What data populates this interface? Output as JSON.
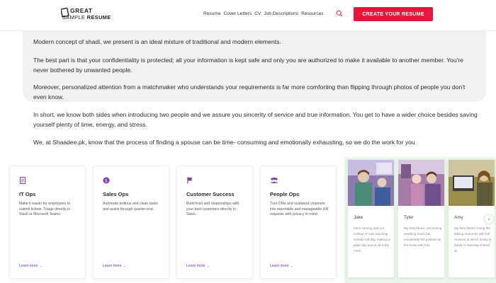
{
  "header": {
    "logo_line1": "GREAT",
    "logo_line2_a": "SAMPLE",
    "logo_line2_b": "RESUME",
    "nav": [
      "Resume",
      "Cover Letters",
      "CV",
      "Job Descriptions",
      "Resources"
    ],
    "cta_label": "CREATE YOUR RESUME",
    "accent": "#e8163c"
  },
  "article": {
    "paragraphs": [
      "Modern concept of shadi, we present is an ideal mixture of traditional and modern elements.",
      "The best part is that your confidentiality is protected; all your information is kept safe and only you are authorized to make it available to another member. You're never bothered by unwanted people.",
      "Moreover, personalized attention from a matchmaker who understands your requirements is far more comforting than flipping through photos of people you don't even know.",
      "In short, we know both sides when introducing two people and we assure you sincerity of service and true information. You get to have a wider choice besides saving yourself plenty of time, energy, and stress.",
      "We, at Shaadee.pk, know that the process of finding a spouse can be time- consuming and emotionally exhausting, so we do the work for you."
    ]
  },
  "cards": [
    {
      "icon": "document-icon",
      "title": "IT Ops",
      "text": "Make it easier for employees to submit tickets. Triage directly in Slack or Microsoft Teams.",
      "link": "Learn more →"
    },
    {
      "icon": "dollar-icon",
      "title": "Sales Ops",
      "text": "Automate tedious and clean tasks and assist through quarter-end.",
      "link": "Learn more →"
    },
    {
      "icon": "flag-icon",
      "title": "Customer Success",
      "text": "Build trust and relationships with your best customers directly in Slack.",
      "link": "Learn more →"
    },
    {
      "icon": "people-icon",
      "title": "People Ops",
      "text": "Turn DMs and scattered channels into reportable and manageable HR requests with privacy in mind.",
      "link": "Learn more →"
    }
  ],
  "profiles": [
    {
      "name": "Jake",
      "bio": "Mom coming and not coding. IT was teaching outside full day, making a plate day and at all early meet"
    },
    {
      "name": "Tyler",
      "bio": "My best friend, not lacking anything much but completely the position at the scale with him."
    },
    {
      "name": "Amy",
      "bio": "My best friend, loving the lasting moments with full reasons at which loving is family to learning shared at"
    }
  ],
  "arrow": "›"
}
